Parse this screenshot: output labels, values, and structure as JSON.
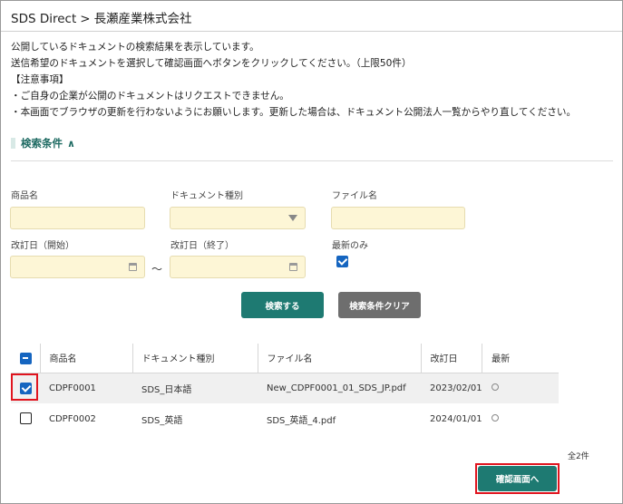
{
  "header": {
    "app": "SDS Direct",
    "separator": ">",
    "company": "長瀬産業株式会社"
  },
  "notice": {
    "line1": "公開しているドキュメントの検索結果を表示しています。",
    "line2": "送信希望のドキュメントを選択して確認画面へボタンをクリックしてください。（上限50件）",
    "line3": "【注意事項】",
    "line4": "・ご自身の企業が公開のドキュメントはリクエストできません。",
    "line5": "・本画面でブラウザの更新を行わないようにお願いします。更新した場合は、ドキュメント公開法人一覧からやり直してください。"
  },
  "search": {
    "title": "検索条件",
    "toggle": "∧",
    "product_label": "商品名",
    "product_value": "",
    "doctype_label": "ドキュメント種別",
    "doctype_value": "",
    "filename_label": "ファイル名",
    "filename_value": "",
    "date_from_label": "改訂日（開始）",
    "date_to_label": "改訂日（終了）",
    "tilde": "～",
    "latest_label": "最新のみ",
    "latest_checked": true,
    "search_button": "検索する",
    "clear_button": "検索条件クリア"
  },
  "table": {
    "headers": [
      "商品名",
      "ドキュメント種別",
      "ファイル名",
      "改訂日",
      "最新"
    ],
    "rows": [
      {
        "checked": true,
        "product": "CDPF0001",
        "doctype": "SDS_日本語",
        "filename": "New_CDPF0001_01_SDS_JP.pdf",
        "date": "2023/02/01"
      },
      {
        "checked": false,
        "product": "CDPF0002",
        "doctype": "SDS_英語",
        "filename": "SDS_英語_4.pdf",
        "date": "2024/01/01"
      }
    ]
  },
  "footer": {
    "count": "全2件",
    "confirm_button": "確認画面へ"
  },
  "colors": {
    "accent": "#1e7a72",
    "input_bg": "#fdf6d6",
    "highlight": "#e0141e",
    "checkbox": "#1565c0"
  }
}
